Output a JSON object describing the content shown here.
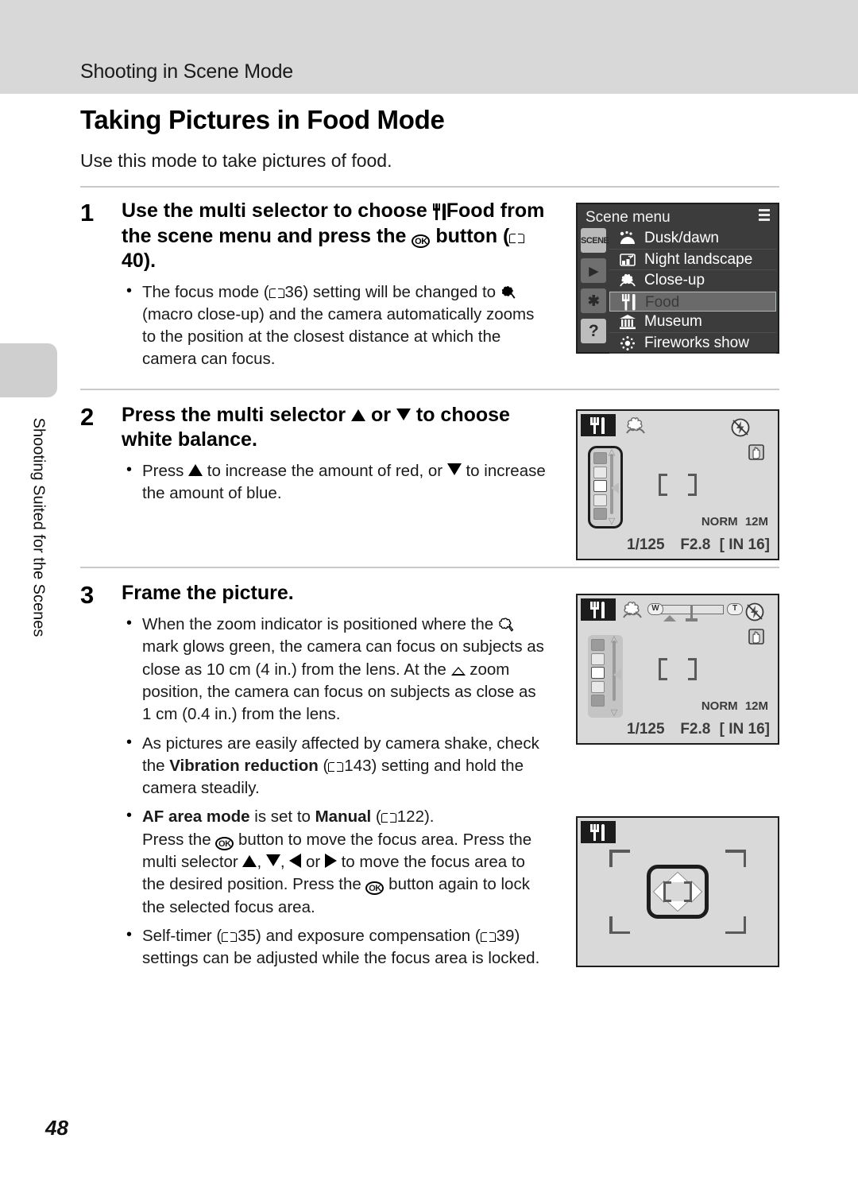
{
  "header": {
    "section_title": "Shooting in Scene Mode"
  },
  "side_tab": {
    "label": "Shooting Suited for the Scenes"
  },
  "page": {
    "heading": "Taking Pictures in Food Mode",
    "intro": "Use this mode to take pictures of food.",
    "number": "48"
  },
  "steps": [
    {
      "number": "1",
      "title_pre": "Use the multi selector to choose ",
      "title_bold": "Food",
      "title_mid": " from the scene menu and press the ",
      "title_post": " button (",
      "title_ref": "40",
      "title_end": ").",
      "bullets": [
        {
          "pre": "The focus mode (",
          "ref": "36",
          "mid": ") setting will be changed to ",
          "post": " (macro close-up) and the camera automatically zooms to the position at the closest distance at which the camera can focus."
        }
      ]
    },
    {
      "number": "2",
      "title_pre": "Press the multi selector ",
      "title_mid": " or ",
      "title_post": " to choose white balance.",
      "bullets": [
        {
          "pre": "Press ",
          "mid": " to increase the amount of red, or ",
          "post": " to increase the amount of blue."
        }
      ]
    },
    {
      "number": "3",
      "title": "Frame the picture.",
      "bullets": [
        {
          "pre": "When the zoom indicator is positioned where the ",
          "mid": " mark glows green, the camera can focus on subjects as close as 10 cm (4 in.) from the lens. At the ",
          "post": " zoom position, the camera can focus on subjects as close as 1 cm (0.4 in.) from the lens."
        },
        {
          "pre": "As pictures are easily affected by camera shake, check the ",
          "bold": "Vibration reduction",
          "mid": " (",
          "ref": "143",
          "post": ") setting and hold the camera steadily."
        },
        {
          "bold1": "AF area mode",
          "mid1": " is set to ",
          "bold2": "Manual",
          "mid2": " (",
          "ref": "122",
          "mid3": ").",
          "line2_a": "Press the ",
          "line2_b": " button to move the focus area. Press the multi selector ",
          "line2_c": ", ",
          "line2_d": ", ",
          "line2_e": " or ",
          "line2_f": " to move the focus area to the desired position. Press the ",
          "line2_g": " button again to lock the selected focus area."
        },
        {
          "pre": "Self-timer (",
          "ref1": "35",
          "mid": ") and exposure compensation (",
          "ref2": "39",
          "post": ") settings can be adjusted while the focus area is locked."
        }
      ]
    }
  ],
  "scene_menu": {
    "title": "Scene menu",
    "sidebar_icons": [
      "scene-tab",
      "playback-tab",
      "setup-tab",
      "help-tab"
    ],
    "sidebar_scene_label": "SCENE",
    "sidebar_help_label": "?",
    "items": [
      {
        "label": "Dusk/dawn",
        "icon": "dusk-dawn-icon",
        "selected": false
      },
      {
        "label": "Night landscape",
        "icon": "night-landscape-icon",
        "selected": false
      },
      {
        "label": "Close-up",
        "icon": "close-up-icon",
        "selected": false
      },
      {
        "label": "Food",
        "icon": "food-icon",
        "selected": true
      },
      {
        "label": "Museum",
        "icon": "museum-icon",
        "selected": false
      },
      {
        "label": "Fireworks show",
        "icon": "fireworks-icon",
        "selected": false
      }
    ]
  },
  "lcd_screens": [
    {
      "name": "white-balance-screen",
      "mode_icon": "food-icon",
      "macro_icon": "macro-icon",
      "flash_icon": "flash-off-icon",
      "vr_icon": "vibration-reduction-icon",
      "shutter_speed": "1/125",
      "aperture": "F2.8",
      "memory": "[ IN  16]",
      "quality": "NORM",
      "image_size": "12M",
      "wb_slider_cells": 5,
      "wb_selected_index": 2,
      "zoom_indicator": false
    },
    {
      "name": "zoom-indicator-screen",
      "mode_icon": "food-icon",
      "macro_icon": "macro-icon",
      "flash_icon": "flash-off-icon",
      "vr_icon": "vibration-reduction-icon",
      "shutter_speed": "1/125",
      "aperture": "F2.8",
      "memory": "[ IN  16]",
      "quality": "NORM",
      "image_size": "12M",
      "wb_slider_cells": 5,
      "wb_selected_index": 2,
      "zoom_indicator": true,
      "zoom_wide_label": "W",
      "zoom_tele_label": "T"
    },
    {
      "name": "focus-area-screen",
      "mode_icon": "food-icon",
      "multi_selector_pad": true
    }
  ]
}
